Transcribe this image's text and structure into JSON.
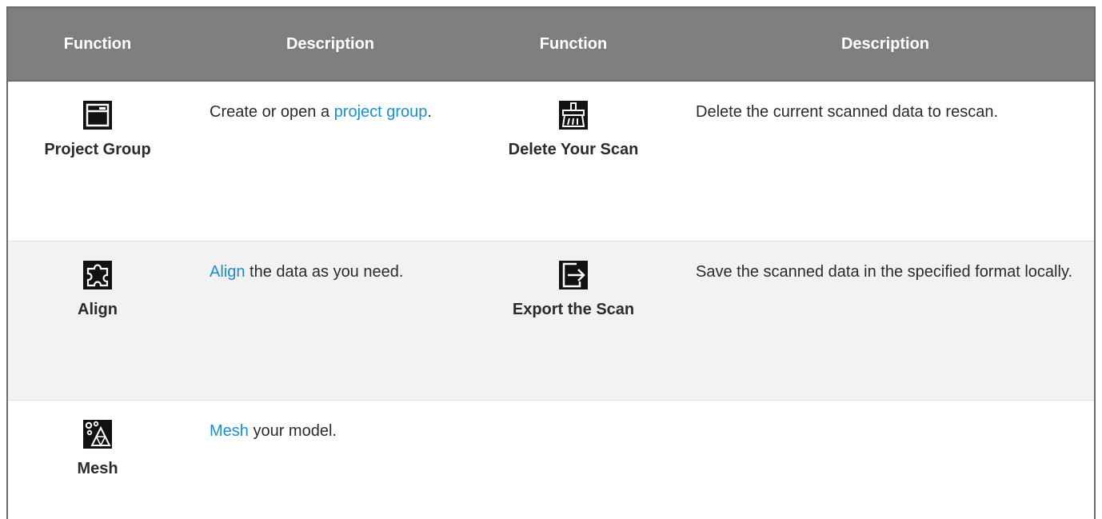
{
  "table": {
    "headers": [
      "Function",
      "Description",
      "Function",
      "Description"
    ],
    "rows": [
      {
        "left": {
          "icon": "project-group-icon",
          "label": "Project Group",
          "desc_prefix": "Create or open a ",
          "desc_link": "project group",
          "desc_suffix": "."
        },
        "right": {
          "icon": "broom-icon",
          "label": "Delete Your Scan",
          "desc": "Delete the current scanned data to rescan."
        }
      },
      {
        "left": {
          "icon": "puzzle-icon",
          "label": "Align",
          "desc_link": "Align",
          "desc_suffix": " the data as you need."
        },
        "right": {
          "icon": "export-icon",
          "label": "Export the Scan",
          "desc": "Save the scanned data in the specified format locally."
        }
      },
      {
        "left": {
          "icon": "mesh-icon",
          "label": "Mesh",
          "desc_link": "Mesh",
          "desc_suffix": " your model."
        }
      }
    ]
  },
  "colors": {
    "header_bg": "#7f7f7f",
    "link": "#1a8fd0",
    "alt_row_bg": "#f2f2f2"
  }
}
